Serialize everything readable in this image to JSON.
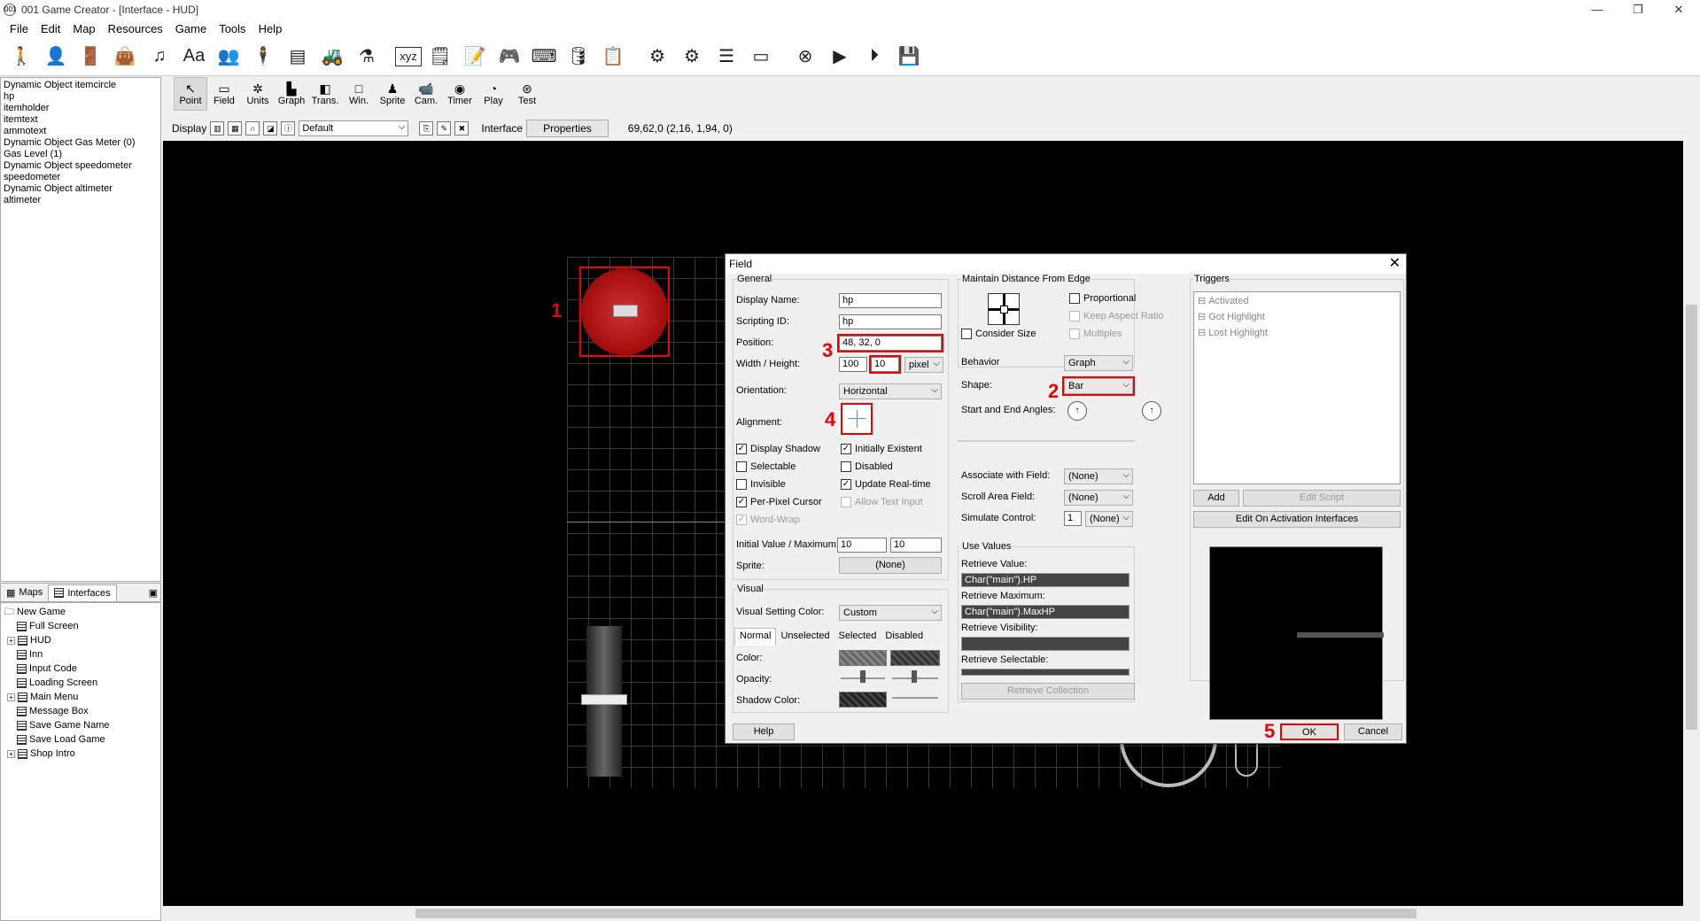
{
  "window": {
    "title": "001 Game Creator - [Interface - HUD]",
    "icon": "001"
  },
  "menu": [
    "File",
    "Edit",
    "Map",
    "Resources",
    "Game",
    "Tools",
    "Help"
  ],
  "objects": [
    "Dynamic Object itemcircle",
    "hp",
    "itemholder",
    "itemtext",
    "ammotext",
    "Dynamic Object Gas Meter (0)",
    "Gas Level (1)",
    "Dynamic Object speedometer",
    "speedometer",
    "Dynamic Object altimeter",
    "altimeter"
  ],
  "tree_tabs": {
    "maps": "Maps",
    "interfaces": "Interfaces"
  },
  "tree": {
    "root": "New Game",
    "items": [
      "Full Screen",
      "HUD",
      "Inn",
      "Input Code",
      "Loading Screen",
      "Main Menu",
      "Message Box",
      "Save Game Name",
      "Save Load Game",
      "Shop Intro"
    ]
  },
  "modes": [
    "Point",
    "Field",
    "Units",
    "Graph",
    "Trans.",
    "Win.",
    "Sprite",
    "Cam.",
    "Timer",
    "Play",
    "Test"
  ],
  "display_bar": {
    "display": "Display",
    "view": "Default",
    "interface": "Interface",
    "properties": "Properties",
    "coords": "69,62,0 (2,16, 1,94, 0)"
  },
  "dialog": {
    "title": "Field",
    "general": {
      "group": "General",
      "display_name_label": "Display Name:",
      "display_name": "hp",
      "scripting_id_label": "Scripting ID:",
      "scripting_id": "hp",
      "position_label": "Position:",
      "position": "48, 32, 0",
      "wh_label": "Width / Height:",
      "width": "100",
      "height": "10",
      "unit": "pixel",
      "orientation_label": "Orientation:",
      "orientation": "Horizontal",
      "alignment_label": "Alignment:",
      "checks": {
        "display_shadow": "Display Shadow",
        "initially_existent": "Initially Existent",
        "selectable": "Selectable",
        "disabled": "Disabled",
        "invisible": "Invisible",
        "update_realtime": "Update Real-time",
        "per_pixel": "Per-Pixel Cursor",
        "allow_text": "Allow Text Input",
        "word_wrap": "Word-Wrap"
      },
      "initial_max_label": "Initial Value / Maximum:",
      "initial": "10",
      "maximum": "10",
      "sprite_label": "Sprite:",
      "sprite": "(None)"
    },
    "visual": {
      "group": "Visual",
      "setting_label": "Visual Setting Color:",
      "setting": "Custom",
      "tabs": [
        "Normal",
        "Unselected",
        "Selected",
        "Disabled"
      ],
      "color_label": "Color:",
      "opacity_label": "Opacity:",
      "shadow_label": "Shadow Color:"
    },
    "edge": {
      "group": "Maintain Distance From Edge",
      "proportional": "Proportional",
      "keep_aspect": "Keep Aspect Ratio",
      "multiples": "Multiples",
      "consider_size": "Consider Size"
    },
    "behavior_label": "Behavior",
    "behavior": "Graph",
    "shape_label": "Shape:",
    "shape": "Bar",
    "angles_label": "Start and End Angles:",
    "assoc_label": "Associate with Field:",
    "assoc": "(None)",
    "scroll_label": "Scroll Area Field:",
    "scroll": "(None)",
    "simulate_label": "Simulate Control:",
    "simulate_num": "1",
    "simulate": "(None)",
    "use_values": {
      "group": "Use Values",
      "retrieve_value_label": "Retrieve Value:",
      "retrieve_value": "Char(\"main\").HP",
      "retrieve_max_label": "Retrieve Maximum:",
      "retrieve_max": "Char(\"main\").MaxHP",
      "retrieve_vis_label": "Retrieve Visibility:",
      "retrieve_sel_label": "Retrieve Selectable:",
      "collection": "Retrieve Collection"
    },
    "triggers": {
      "group": "Triggers",
      "items": [
        "Activated",
        "Got Highlight",
        "Lost Highlight"
      ],
      "add": "Add",
      "edit_script": "Edit Script",
      "edit_on_activation": "Edit On Activation Interfaces"
    },
    "help": "Help",
    "ok": "OK",
    "cancel": "Cancel"
  },
  "annotations": [
    "1",
    "2",
    "3",
    "4",
    "5"
  ]
}
